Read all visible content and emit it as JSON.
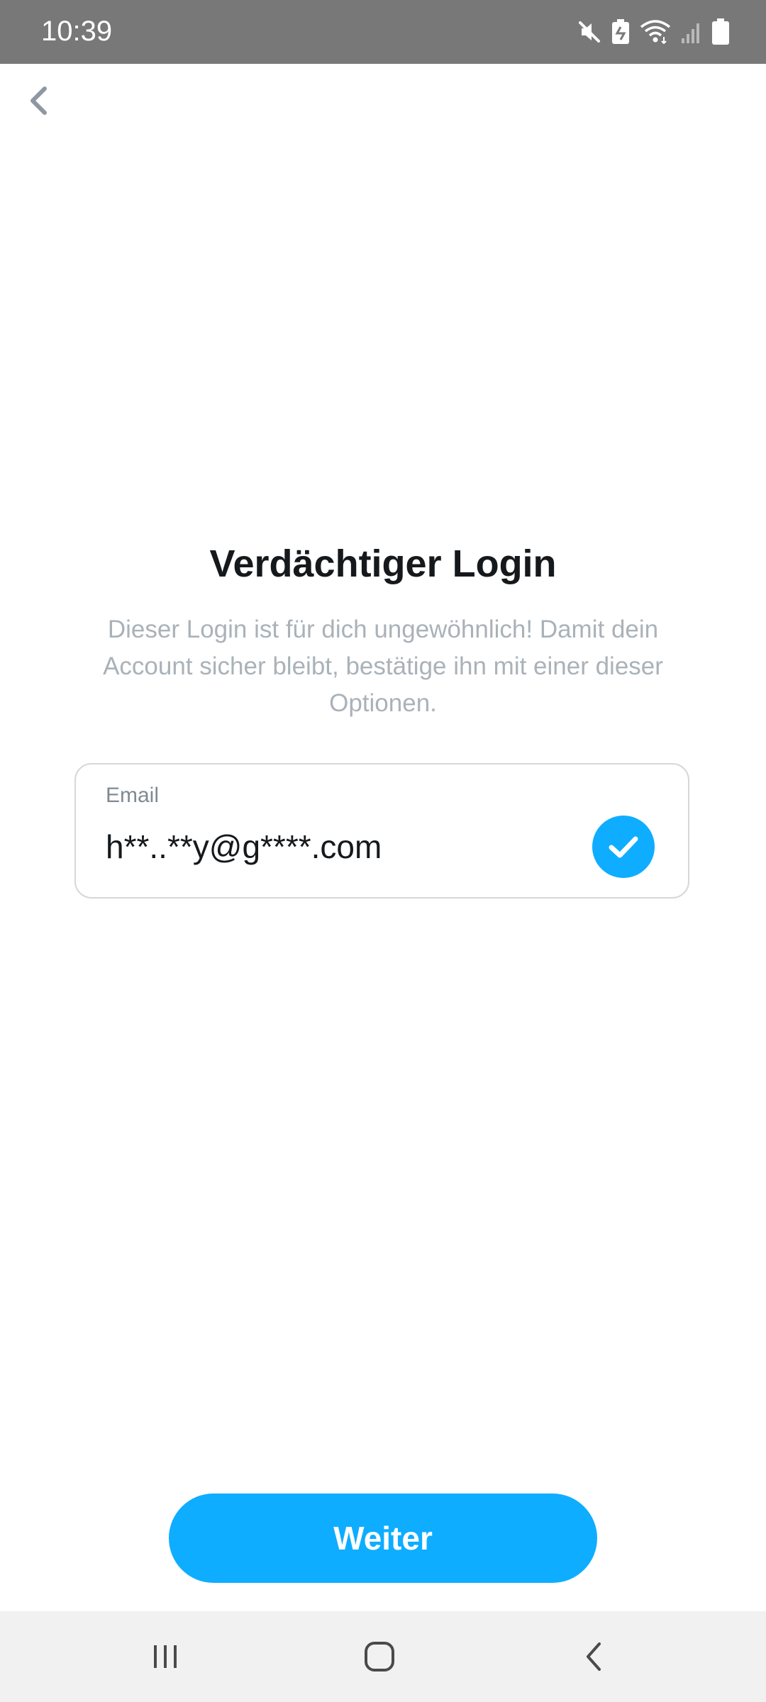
{
  "status_bar": {
    "time": "10:39",
    "icons": [
      "mute-icon",
      "battery-saver-icon",
      "wifi-icon",
      "signal-icon",
      "battery-icon"
    ]
  },
  "header": {
    "back_icon": "chevron-left-icon"
  },
  "main": {
    "title": "Verdächtiger Login",
    "subtitle": "Dieser Login ist für dich ungewöhnlich! Damit dein Account sicher bleibt, bestätige ihn mit einer dieser Optionen.",
    "email_option": {
      "label": "Email",
      "value": "h**..**y@g****.com",
      "selected": true,
      "check_icon": "checkmark-icon"
    },
    "continue_label": "Weiter"
  },
  "nav_bar": {
    "icons": [
      "recent-apps-icon",
      "home-icon",
      "back-icon"
    ]
  },
  "colors": {
    "accent": "#0eadff",
    "title_text": "#16191c",
    "subtitle_text": "#aab2b9",
    "status_bar": "#787878",
    "nav_bar": "#f1f1f1"
  }
}
